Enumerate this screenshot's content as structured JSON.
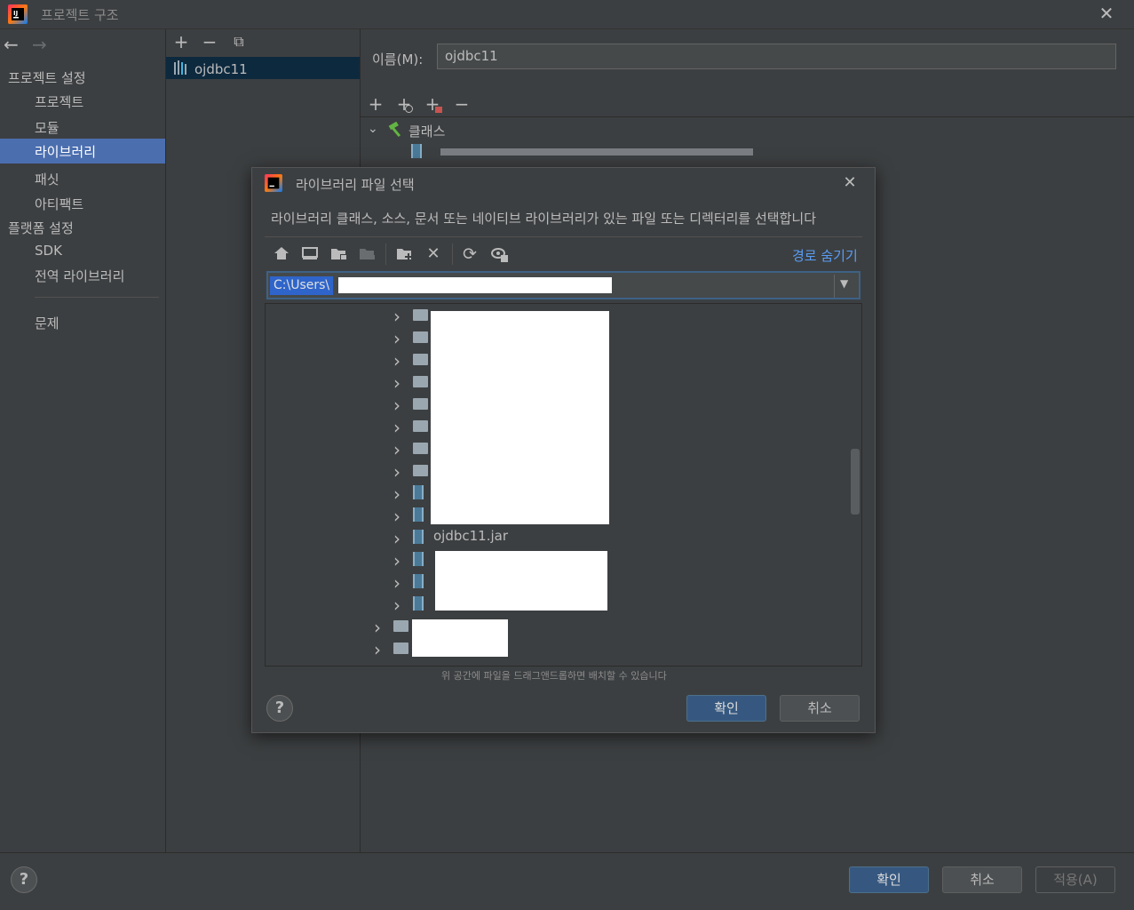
{
  "window": {
    "title": "프로젝트 구조",
    "close": "✕"
  },
  "nav": {
    "back": "←",
    "forward": "→",
    "project_settings": "프로젝트 설정",
    "items": [
      "프로젝트",
      "모듈",
      "라이브러리",
      "패싯",
      "아티팩트"
    ],
    "platform_settings": "플랫폼 설정",
    "platform_items": [
      "SDK",
      "전역 라이브러리"
    ],
    "problems": "문제",
    "selected": "라이브러리"
  },
  "libraries": {
    "toolbar": {
      "add": "+",
      "remove": "−",
      "copy": "⧉"
    },
    "items": [
      "ojdbc11"
    ]
  },
  "detail": {
    "name_label": "이름(M):",
    "name_value": "ojdbc11",
    "toolbar": {
      "add": "+",
      "add_ext": "+",
      "add_special": "+",
      "remove": "−"
    },
    "classes_label": "클래스"
  },
  "dialog": {
    "title": "라이브러리 파일 선택",
    "close": "✕",
    "description": "라이브러리 클래스, 소스, 문서 또는 네이티브 라이브러리가 있는 파일 또는 디렉터리를 선택합니다",
    "hide_path": "경로 숨기기",
    "path_value": "C:\\Users\\",
    "tree_items": [
      {
        "kind": "folder",
        "label": ""
      },
      {
        "kind": "folder",
        "label": ""
      },
      {
        "kind": "folder",
        "label": ""
      },
      {
        "kind": "folder",
        "label": ""
      },
      {
        "kind": "folder",
        "label": ""
      },
      {
        "kind": "folder",
        "label": ""
      },
      {
        "kind": "folder",
        "label": ""
      },
      {
        "kind": "folder",
        "label": ""
      },
      {
        "kind": "jar",
        "label": ""
      },
      {
        "kind": "jar",
        "label": ""
      },
      {
        "kind": "jar",
        "label": "ojdbc11.jar"
      },
      {
        "kind": "jar",
        "label": ""
      },
      {
        "kind": "jar",
        "label": ""
      },
      {
        "kind": "jar",
        "label": ""
      }
    ],
    "parent_items": [
      {
        "kind": "folder",
        "label": ""
      },
      {
        "kind": "folder",
        "label": ""
      }
    ],
    "drop_hint": "위 공간에 파일을 드래그앤드롭하면 배치할 수 있습니다",
    "ok": "확인",
    "cancel": "취소",
    "help": "?"
  },
  "footer": {
    "help": "?",
    "ok": "확인",
    "cancel": "취소",
    "apply": "적용(A)"
  },
  "colors": {
    "accent": "#4b6eaf",
    "primary_button": "#365880",
    "background": "#3c3f41"
  }
}
